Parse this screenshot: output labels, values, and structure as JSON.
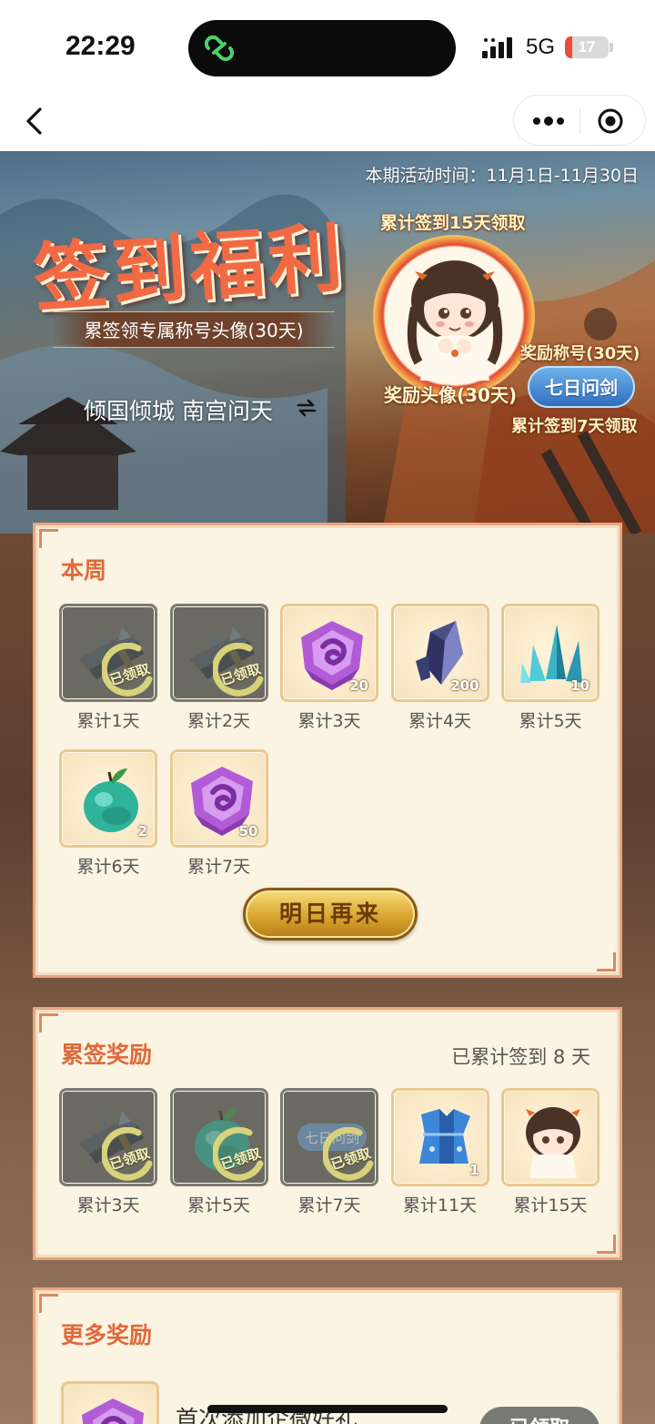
{
  "status_bar": {
    "time": "22:29",
    "network": "5G",
    "battery_level": "17",
    "battery_fraction": 0.17,
    "battery_color": "#e94b3c",
    "icons": [
      "app-activity-icon",
      "signal-icon",
      "battery-icon"
    ]
  },
  "nav": {
    "icons": [
      "back-icon",
      "more-icon",
      "close-target-icon"
    ]
  },
  "banner": {
    "period": "本期活动时间：11月1日-11月30日",
    "title": "签到福利",
    "subtitle": "累签领专属称号头像(30天)",
    "player": "倾国倾城 南宫问天",
    "hint_15": "累计签到15天领取",
    "reward_avatar_label": "奖励头像(30天)",
    "reward_title_label": "奖励称号(30天)",
    "title_badge": "七日问剑",
    "hint_7": "累计签到7天领取"
  },
  "weekly": {
    "title": "本周",
    "claimed_stamp": "已领取",
    "items": [
      {
        "day": "累计1天",
        "icon": "sword-icon",
        "claimed": true
      },
      {
        "day": "累计2天",
        "icon": "sword-icon",
        "claimed": true
      },
      {
        "day": "累计3天",
        "qty": "20",
        "icon": "purple-jade-icon",
        "claimed": false
      },
      {
        "day": "累计4天",
        "qty": "200",
        "icon": "dark-crystal-icon",
        "claimed": false
      },
      {
        "day": "累计5天",
        "qty": "10",
        "icon": "blue-crystal-icon",
        "claimed": false
      },
      {
        "day": "累计6天",
        "qty": "2",
        "icon": "green-fruit-icon",
        "claimed": false
      },
      {
        "day": "累计7天",
        "qty": "50",
        "icon": "purple-jade-icon",
        "claimed": false
      }
    ],
    "button": "明日再来"
  },
  "cumulative": {
    "title": "累签奖励",
    "summary": "已累计签到 8 天",
    "claimed_stamp": "已领取",
    "items": [
      {
        "day": "累计3天",
        "icon": "sword-icon",
        "claimed": true
      },
      {
        "day": "累计5天",
        "icon": "green-fruit-icon",
        "claimed": true
      },
      {
        "day": "累计7天",
        "icon": "title-badge-icon",
        "claimed": true,
        "badge_text": "七日问剑"
      },
      {
        "day": "累计11天",
        "qty": "1",
        "icon": "blue-robe-icon",
        "claimed": false
      },
      {
        "day": "累计15天",
        "icon": "chibi-avatar-icon",
        "claimed": false
      }
    ]
  },
  "more": {
    "title": "更多奖励",
    "item_text": "首次添加企微好礼",
    "button": "已领取"
  },
  "colors": {
    "accent": "#e0693b",
    "panel_bg": "#fbf4e2",
    "panel_border": "#e9a57d",
    "gold_button": "#d9a52e",
    "claimed_gray": "#6a6a62"
  }
}
